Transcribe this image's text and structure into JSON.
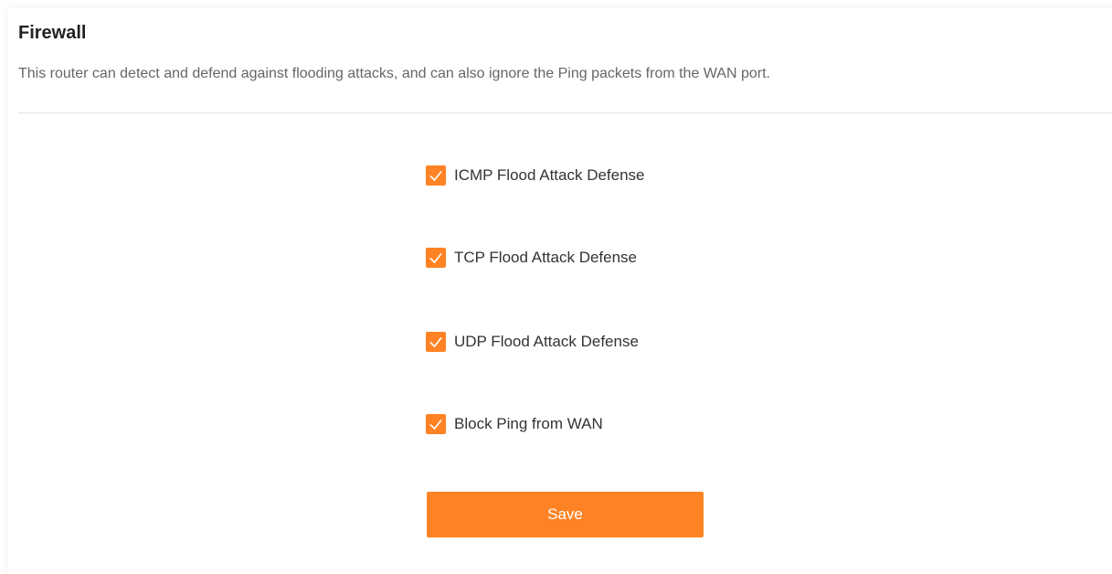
{
  "header": {
    "title": "Firewall",
    "description": "This router can detect and defend against flooding attacks, and can also ignore the Ping packets from the WAN port."
  },
  "options": [
    {
      "label": "ICMP Flood Attack Defense",
      "checked": true
    },
    {
      "label": "TCP Flood Attack Defense",
      "checked": true
    },
    {
      "label": "UDP Flood Attack Defense",
      "checked": true
    },
    {
      "label": "Block Ping from WAN",
      "checked": true
    }
  ],
  "actions": {
    "save_label": "Save"
  },
  "colors": {
    "accent": "#ff8324",
    "divider": "#e3e3e3",
    "title": "#222222",
    "description": "#666666"
  },
  "icons": {
    "checkbox_checked": "check-icon"
  }
}
